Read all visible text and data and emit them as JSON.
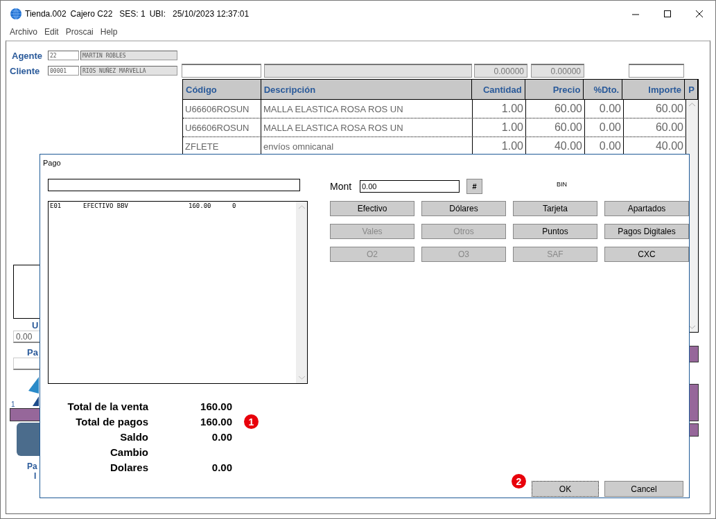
{
  "window": {
    "title": "Tienda.002",
    "cashier": "Cajero C22",
    "session": "SES: 1",
    "location": "UBI:",
    "datetime": "25/10/2023 12:37:01"
  },
  "menu": [
    "Archivo",
    "Edit",
    "Proscai",
    "Help"
  ],
  "agent": {
    "label": "Agente",
    "code": "22",
    "name": "MARTIN ROBLES"
  },
  "client": {
    "label": "Cliente",
    "code": "00001",
    "name": "RIOS NUÑEZ MARVELLA"
  },
  "header_fields": [
    "0.00000",
    "0.00000"
  ],
  "table": {
    "columns": [
      "Código",
      "Descripción",
      "Cantidad",
      "Precio",
      "%Dto.",
      "Importe",
      "P"
    ],
    "rows": [
      [
        "U66606ROSUN",
        "MALLA ELASTICA ROSA ROS UN",
        "1.00",
        "60.00",
        "0.00",
        "60.00"
      ],
      [
        "U66606ROSUN",
        "MALLA ELASTICA ROSA ROS UN",
        "1.00",
        "60.00",
        "0.00",
        "60.00"
      ],
      [
        "ZFLETE",
        "envíos omnicanal",
        "1.00",
        "40.00",
        "0.00",
        "40.00"
      ]
    ]
  },
  "side_panel": {
    "label_1": "U",
    "amount": "0.00",
    "label_2": "Pa",
    "counter": "1",
    "label_3": "Pa",
    "label_4": "I"
  },
  "dialog": {
    "title": "Pago",
    "payments": [
      {
        "code": "E01",
        "name": "EFECTIVO BBV",
        "amount": "160.00",
        "ref": "0"
      }
    ],
    "amount_label": "Mont",
    "amount_value": "0.00",
    "hash_button": "#",
    "bin_label": "BIN",
    "methods": [
      {
        "label": "Efectivo",
        "disabled": false
      },
      {
        "label": "Dólares",
        "disabled": false
      },
      {
        "label": "Tarjeta",
        "disabled": false
      },
      {
        "label": "Apartados",
        "disabled": false
      },
      {
        "label": "Vales",
        "disabled": true
      },
      {
        "label": "Otros",
        "disabled": true
      },
      {
        "label": "Puntos",
        "disabled": false
      },
      {
        "label": "Pagos Digitales",
        "disabled": false
      },
      {
        "label": "O2",
        "disabled": true
      },
      {
        "label": "O3",
        "disabled": true
      },
      {
        "label": "SAF",
        "disabled": true
      },
      {
        "label": "CXC",
        "disabled": false
      }
    ],
    "totals": [
      {
        "label": "Total de la venta",
        "value": "160.00"
      },
      {
        "label": "Total de pagos",
        "value": "160.00"
      },
      {
        "label": "Saldo",
        "value": "0.00"
      },
      {
        "label": "Cambio"
      },
      {
        "label": "Dolares",
        "value": "0.00"
      }
    ],
    "buttons": [
      {
        "label": "OK",
        "focused": true
      },
      {
        "label": "Cancel",
        "focused": false
      }
    ]
  },
  "annotations": [
    "1",
    "2"
  ]
}
